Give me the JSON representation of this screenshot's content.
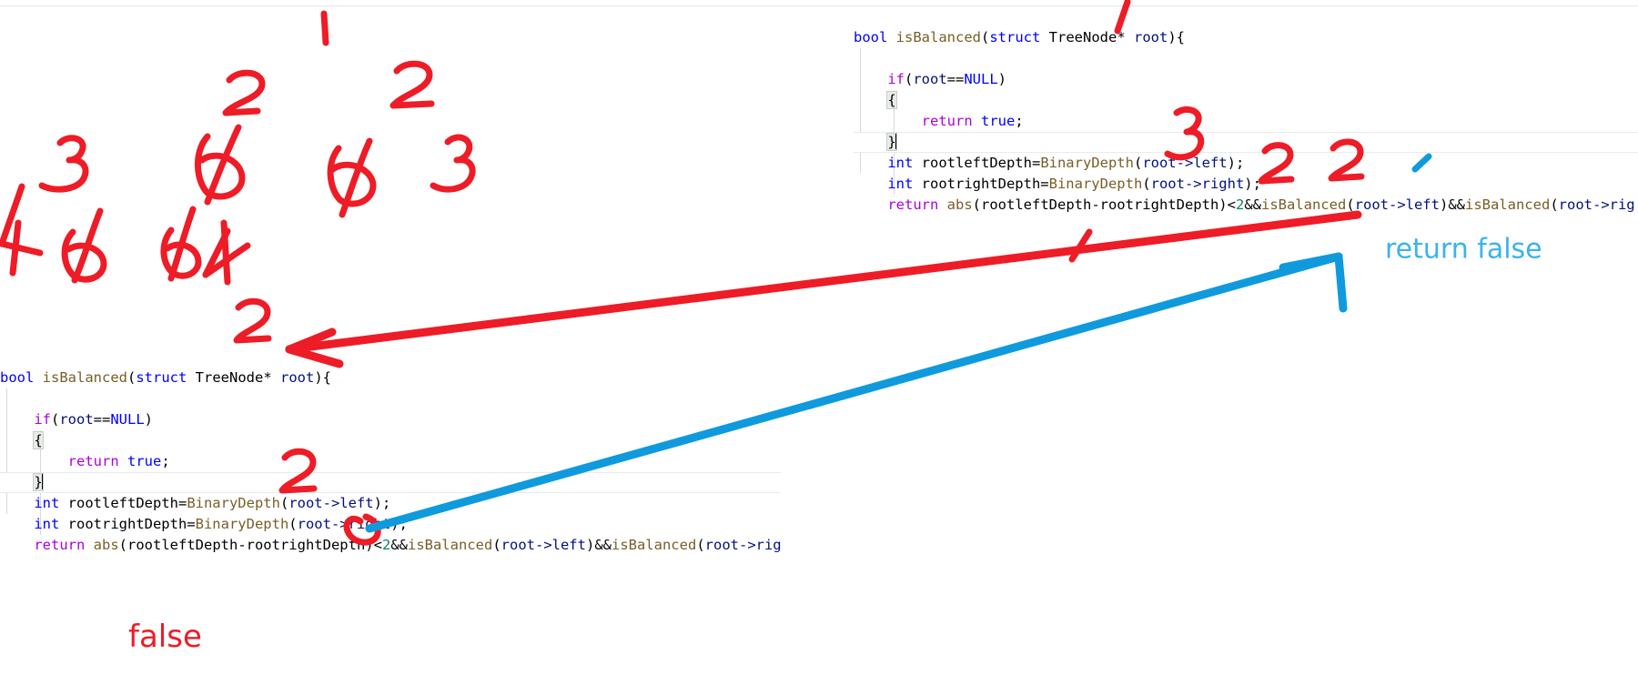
{
  "app": {
    "kind": "code-editor-screenshot-with-ink-annotations",
    "background": "#ffffff",
    "ink_red": "#ee1c26",
    "ink_blue": "#0f9ade",
    "ink_lightblue": "#39b3ef"
  },
  "editor_top": {
    "name": "top-code-pane",
    "lines": [
      {
        "id": "t1",
        "tokens": [
          {
            "t": "bool",
            "c": "k-type"
          },
          {
            "t": " ",
            "c": "k-plain"
          },
          {
            "t": "isBalanced",
            "c": "k-fn"
          },
          {
            "t": "(",
            "c": "k-op"
          },
          {
            "t": "struct",
            "c": "k-type"
          },
          {
            "t": " TreeNode* ",
            "c": "k-plain"
          },
          {
            "t": "root",
            "c": "k-id"
          },
          {
            "t": "){",
            "c": "k-op"
          }
        ]
      },
      {
        "id": "t2",
        "tokens": []
      },
      {
        "id": "t3",
        "tokens": [
          {
            "t": "    ",
            "c": "k-plain"
          },
          {
            "t": "if",
            "c": "k-kw"
          },
          {
            "t": "(",
            "c": "k-op"
          },
          {
            "t": "root",
            "c": "k-id"
          },
          {
            "t": "==",
            "c": "k-op"
          },
          {
            "t": "NULL",
            "c": "k-lit"
          },
          {
            "t": ")",
            "c": "k-op"
          }
        ]
      },
      {
        "id": "t4",
        "tokens": [
          {
            "t": "    ",
            "c": "k-plain"
          },
          {
            "t": "{",
            "c": "k-op brace-box"
          }
        ]
      },
      {
        "id": "t5",
        "tokens": [
          {
            "t": "        ",
            "c": "k-plain"
          },
          {
            "t": "return",
            "c": "k-kw"
          },
          {
            "t": " ",
            "c": "k-plain"
          },
          {
            "t": "true",
            "c": "k-lit"
          },
          {
            "t": ";",
            "c": "k-op"
          }
        ]
      },
      {
        "id": "t6",
        "highlight": true,
        "caret": true,
        "tokens": [
          {
            "t": "    ",
            "c": "k-plain"
          },
          {
            "t": "}",
            "c": "k-op brace-box"
          }
        ]
      },
      {
        "id": "t7",
        "tokens": [
          {
            "t": "    ",
            "c": "k-plain"
          },
          {
            "t": "int",
            "c": "k-type"
          },
          {
            "t": " rootleftDepth=",
            "c": "k-plain"
          },
          {
            "t": "BinaryDepth",
            "c": "k-fn"
          },
          {
            "t": "(",
            "c": "k-op"
          },
          {
            "t": "root->left",
            "c": "k-id"
          },
          {
            "t": ");",
            "c": "k-op"
          }
        ]
      },
      {
        "id": "t8",
        "tokens": [
          {
            "t": "    ",
            "c": "k-plain"
          },
          {
            "t": "int",
            "c": "k-type"
          },
          {
            "t": " rootrightDepth=",
            "c": "k-plain"
          },
          {
            "t": "BinaryDepth",
            "c": "k-fn"
          },
          {
            "t": "(",
            "c": "k-op"
          },
          {
            "t": "root->right",
            "c": "k-id"
          },
          {
            "t": ");",
            "c": "k-op"
          }
        ]
      },
      {
        "id": "t9",
        "tokens": [
          {
            "t": "    ",
            "c": "k-plain"
          },
          {
            "t": "return",
            "c": "k-kw"
          },
          {
            "t": " ",
            "c": "k-plain"
          },
          {
            "t": "abs",
            "c": "k-fn"
          },
          {
            "t": "(rootleftDepth-rootrightDepth)<",
            "c": "k-op"
          },
          {
            "t": "2",
            "c": "k-num"
          },
          {
            "t": "&&",
            "c": "k-op"
          },
          {
            "t": "isBalanced",
            "c": "k-fn"
          },
          {
            "t": "(",
            "c": "k-op"
          },
          {
            "t": "root->left",
            "c": "k-id"
          },
          {
            "t": ")&&",
            "c": "k-op"
          },
          {
            "t": "isBalanced",
            "c": "k-fn"
          },
          {
            "t": "(",
            "c": "k-op"
          },
          {
            "t": "root->rig",
            "c": "k-id"
          }
        ]
      },
      {
        "id": "t10",
        "tokens": [
          {
            "t": "}",
            "c": "k-op"
          }
        ]
      }
    ]
  },
  "editor_bottom": {
    "name": "bottom-code-pane",
    "lines": [
      {
        "id": "b1",
        "tokens": [
          {
            "t": "bool",
            "c": "k-type"
          },
          {
            "t": " ",
            "c": "k-plain"
          },
          {
            "t": "isBalanced",
            "c": "k-fn"
          },
          {
            "t": "(",
            "c": "k-op"
          },
          {
            "t": "struct",
            "c": "k-type"
          },
          {
            "t": " TreeNode* ",
            "c": "k-plain"
          },
          {
            "t": "root",
            "c": "k-id"
          },
          {
            "t": "){",
            "c": "k-op"
          }
        ]
      },
      {
        "id": "b2",
        "tokens": []
      },
      {
        "id": "b3",
        "tokens": [
          {
            "t": "    ",
            "c": "k-plain"
          },
          {
            "t": "if",
            "c": "k-kw"
          },
          {
            "t": "(",
            "c": "k-op"
          },
          {
            "t": "root",
            "c": "k-id"
          },
          {
            "t": "==",
            "c": "k-op"
          },
          {
            "t": "NULL",
            "c": "k-lit"
          },
          {
            "t": ")",
            "c": "k-op"
          }
        ]
      },
      {
        "id": "b4",
        "tokens": [
          {
            "t": "    ",
            "c": "k-plain"
          },
          {
            "t": "{",
            "c": "k-op brace-box"
          }
        ]
      },
      {
        "id": "b5",
        "tokens": [
          {
            "t": "        ",
            "c": "k-plain"
          },
          {
            "t": "return",
            "c": "k-kw"
          },
          {
            "t": " ",
            "c": "k-plain"
          },
          {
            "t": "true",
            "c": "k-lit"
          },
          {
            "t": ";",
            "c": "k-op"
          }
        ]
      },
      {
        "id": "b6",
        "highlight": true,
        "caret": true,
        "tokens": [
          {
            "t": "    ",
            "c": "k-plain"
          },
          {
            "t": "}",
            "c": "k-op brace-box"
          }
        ]
      },
      {
        "id": "b7",
        "tokens": [
          {
            "t": "    ",
            "c": "k-plain"
          },
          {
            "t": "int",
            "c": "k-type"
          },
          {
            "t": " rootleftDepth=",
            "c": "k-plain"
          },
          {
            "t": "BinaryDepth",
            "c": "k-fn"
          },
          {
            "t": "(",
            "c": "k-op"
          },
          {
            "t": "root->left",
            "c": "k-id"
          },
          {
            "t": ");",
            "c": "k-op"
          }
        ]
      },
      {
        "id": "b8",
        "tokens": [
          {
            "t": "    ",
            "c": "k-plain"
          },
          {
            "t": "int",
            "c": "k-type"
          },
          {
            "t": " rootrightDepth=",
            "c": "k-plain"
          },
          {
            "t": "BinaryDepth",
            "c": "k-fn"
          },
          {
            "t": "(",
            "c": "k-op"
          },
          {
            "t": "root->right",
            "c": "k-id"
          },
          {
            "t": ");",
            "c": "k-op"
          }
        ]
      },
      {
        "id": "b9",
        "tokens": [
          {
            "t": "    ",
            "c": "k-plain"
          },
          {
            "t": "return",
            "c": "k-kw"
          },
          {
            "t": " ",
            "c": "k-plain"
          },
          {
            "t": "abs",
            "c": "k-fn"
          },
          {
            "t": "(rootleftDepth-rootrightDepth)<",
            "c": "k-op"
          },
          {
            "t": "2",
            "c": "k-num"
          },
          {
            "t": "&&",
            "c": "k-op"
          },
          {
            "t": "isBalanced",
            "c": "k-fn"
          },
          {
            "t": "(",
            "c": "k-op"
          },
          {
            "t": "root->left",
            "c": "k-id"
          },
          {
            "t": ")&&",
            "c": "k-op"
          },
          {
            "t": "isBalanced",
            "c": "k-fn"
          },
          {
            "t": "(",
            "c": "k-op"
          },
          {
            "t": "root->rig",
            "c": "k-id"
          }
        ]
      },
      {
        "id": "b10",
        "tokens": [
          {
            "t": "}",
            "c": "k-op"
          }
        ]
      }
    ]
  },
  "annotations": {
    "false_label": "false",
    "return_false_label": "return false",
    "tree_sketch": {
      "description": "hand-drawn binary tree of node values, red ink",
      "levels": [
        [
          "1"
        ],
        [
          "2",
          "2"
        ],
        [
          "3",
          "ϕ",
          "ϕ",
          "3"
        ],
        [
          "4",
          "ϕ",
          "ϕ",
          "4"
        ]
      ]
    },
    "call_order_marks": [
      {
        "label": "1",
        "near": "top-pane-function-signature"
      },
      {
        "label": "3",
        "near": "top-pane-rootleftDepth-line"
      },
      {
        "label": "2",
        "near": "top-pane-rootrightDepth-line"
      },
      {
        "label": "2",
        "near": "top-pane-isBalanced-left-call"
      },
      {
        "label": "1",
        "near": "top-pane-return-line"
      },
      {
        "label": "2",
        "near": "bottom-pane-closing-brace"
      },
      {
        "label": "2",
        "near": "red-arrow-tail-to-bottom-pane"
      }
    ]
  }
}
